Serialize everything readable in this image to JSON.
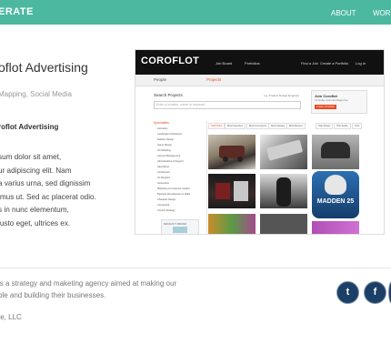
{
  "header": {
    "brand": "ERATE",
    "nav": [
      {
        "label": "ABOUT"
      },
      {
        "label": "WORK"
      }
    ]
  },
  "project": {
    "title": "oflot Advertising",
    "tags": "Mapping, Social Media",
    "client": "roflot Advertising",
    "description_lines": [
      "sum dolor sit amet,",
      "ur adipiscing elit. Nam",
      "a varius urna, sed dignissim",
      "imus ut. Sed ac placerat odio.",
      "s in nunc elementum,",
      "justo eget, ultrices ex."
    ]
  },
  "screenshot": {
    "logo_text": "COROFLOT",
    "top_nav": [
      "Job Board",
      "Portfolios",
      "Find a Job",
      "Create a Portfolio",
      "Log In"
    ],
    "tabs": [
      "People",
      "Projects"
    ],
    "search_label": "Search Projects",
    "search_placeholder": "Enter a location, name or keyword",
    "search_hint": "e.g. Product Design Engineer",
    "join_title": "Join Coroflot",
    "join_sub": "It's simple, clean and always free",
    "join_button": "Create a Portfolio",
    "specialties_title": "Specialties",
    "specialties": [
      "Animation",
      "Landscape Architecture",
      "Fashion Design",
      "Game Design",
      "UX Modeling",
      "Account Management",
      "Administrative & Support",
      "Advertising",
      "Architecture",
      "Art Direction",
      "Automotive",
      "Marketing & Consumer Analyst",
      "Business Development & Sales",
      "Character Design",
      "Conceptual",
      "Content Strategy"
    ],
    "filters": [
      "Staff Picks",
      "Most Favorites",
      "Most Comments",
      "Most Viewed",
      "Most Recent"
    ],
    "view_options": [
      "Title Shows",
      "Title Spells",
      "Grid"
    ],
    "thumb_game_title": "MADDEN 25",
    "thumb_small_caption": "DESIGN IT, BRAND"
  },
  "footer": {
    "description_lines": [
      "is a strategy and maketing agency aimed at making our",
      "ble and building their businesses."
    ],
    "copyright": "te, LLC",
    "social": [
      {
        "icon": "twitter-icon",
        "glyph": "t"
      },
      {
        "icon": "facebook-icon",
        "glyph": "f"
      }
    ]
  },
  "colors": {
    "header_bg": "#4cb8a0",
    "social_bg": "#1b3f66",
    "coroflot_accent": "#e84a23"
  }
}
